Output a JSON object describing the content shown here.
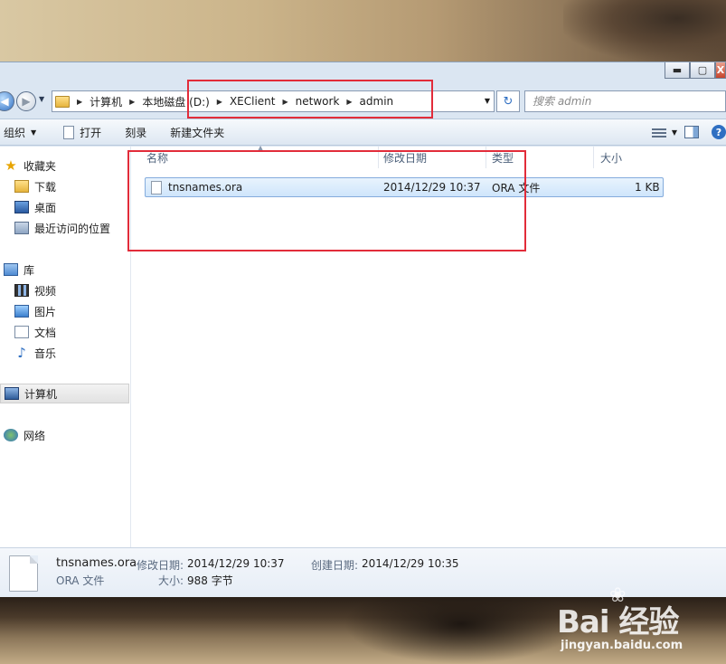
{
  "window": {
    "minimize_glyph": "▬",
    "maximize_glyph": "▢",
    "close_glyph": "X"
  },
  "address_bar": {
    "crumbs": [
      "计算机",
      "本地磁盘 (D:)",
      "XEClient",
      "network",
      "admin"
    ],
    "refresh_glyph": "↻"
  },
  "search": {
    "placeholder": "搜索 admin"
  },
  "command_bar": {
    "organize": "组织",
    "open": "打开",
    "burn": "刻录",
    "new_folder": "新建文件夹",
    "help_glyph": "?"
  },
  "nav_pane": {
    "favorites": "收藏夹",
    "downloads": "下载",
    "desktop": "桌面",
    "recent": "最近访问的位置",
    "libraries": "库",
    "videos": "视频",
    "pictures": "图片",
    "documents": "文档",
    "music": "音乐",
    "computer": "计算机",
    "network": "网络"
  },
  "file_list": {
    "columns": [
      "名称",
      "修改日期",
      "类型",
      "大小"
    ],
    "rows": [
      {
        "name": "tnsnames.ora",
        "modified": "2014/12/29 10:37",
        "type": "ORA 文件",
        "size": "1 KB"
      }
    ]
  },
  "details": {
    "filename": "tnsnames.ora",
    "filetype": "ORA 文件",
    "modified_label": "修改日期:",
    "modified_value": "2014/12/29 10:37",
    "created_label": "创建日期:",
    "created_value": "2014/12/29 10:35",
    "size_label": "大小:",
    "size_value": "988 字节"
  },
  "watermark": {
    "logo": "Bai 经验",
    "url": "jingyan.baidu.com"
  },
  "colors": {
    "annotation_red": "#e22c3a",
    "selection_blue": "#cfe5fb"
  }
}
